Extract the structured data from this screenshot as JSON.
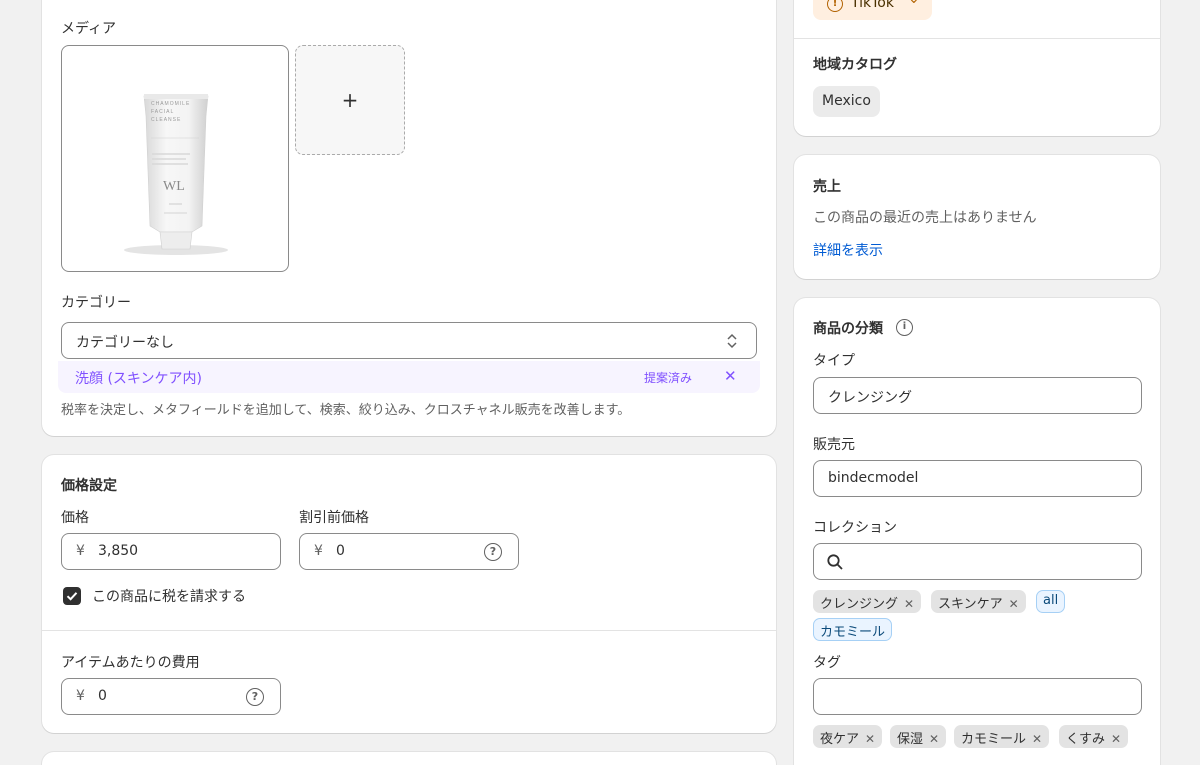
{
  "media": {
    "label": "メディア",
    "add_symbol": "+",
    "product_text": {
      "line1": "CHAMOMILE",
      "line2": "FACIAL",
      "line3": "CLEANSE",
      "logo": "WL"
    }
  },
  "category": {
    "label": "カテゴリー",
    "value": "カテゴリーなし",
    "suggestion": "洗顔 (スキンケア内)",
    "suggested_badge": "提案済み",
    "dismiss": "✕",
    "help": "税率を決定し、メタフィールドを追加して、検索、絞り込み、クロスチャネル販売を改善します。"
  },
  "pricing": {
    "title": "価格設定",
    "price_label": "価格",
    "currency": "¥",
    "price_value": "3,850",
    "compare_label": "割引前価格",
    "compare_value": "0",
    "charge_tax_label": "この商品に税を請求する",
    "cost_label": "アイテムあたりの費用",
    "cost_value": "0"
  },
  "channel": {
    "name": "TikTok",
    "warn": "!",
    "chevron": "⌄"
  },
  "markets": {
    "title": "地域カタログ",
    "items": [
      "Mexico"
    ]
  },
  "sales": {
    "title": "売上",
    "text": "この商品の最近の売上はありません",
    "link": "詳細を表示"
  },
  "organization": {
    "title": "商品の分類",
    "info": "i",
    "type_label": "タイプ",
    "type_value": "クレンジング",
    "vendor_label": "販売元",
    "vendor_value": "bindecmodel",
    "collections_label": "コレクション",
    "collections": [
      {
        "label": "クレンジング",
        "x": "✕"
      },
      {
        "label": "スキンケア",
        "x": "✕"
      },
      {
        "label": "all"
      },
      {
        "label": "カモミール"
      }
    ],
    "tags_label": "タグ",
    "tags": [
      {
        "label": "夜ケア",
        "x": "✕"
      },
      {
        "label": "保湿",
        "x": "✕"
      },
      {
        "label": "カモミール",
        "x": "✕"
      },
      {
        "label": "くすみ",
        "x": "✕"
      }
    ]
  },
  "colors": {
    "accent_purple": "#8051ff",
    "link_blue": "#005bd3",
    "tiktok_bg": "#ffefe0"
  }
}
